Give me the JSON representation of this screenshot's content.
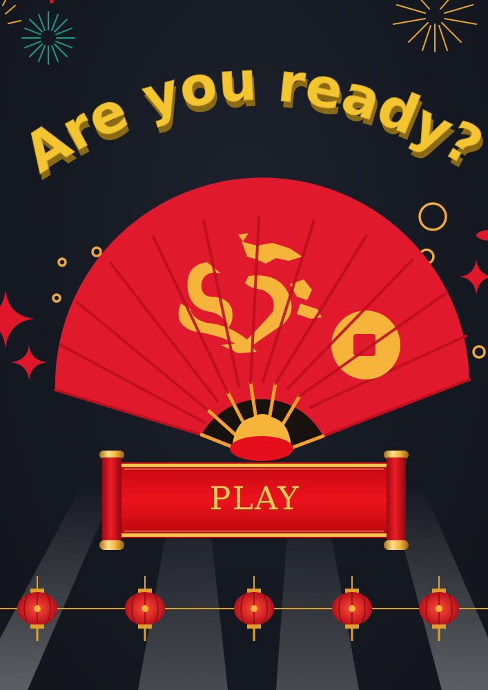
{
  "title": "Are you ready?",
  "play_button": {
    "label": "PLAY"
  },
  "colors": {
    "background": "#151922",
    "title_yellow": "#f2c531",
    "title_shadow": "#8a6a14",
    "fan_red": "#e01a2c",
    "fan_rib": "#c01020",
    "gold": "#f6b43a",
    "scroll_red": "#e00d18",
    "accent_red": "#e0162a"
  },
  "decorations": {
    "fan_motifs": [
      "dragon-icon",
      "coin-icon"
    ],
    "lantern_count": 5
  }
}
